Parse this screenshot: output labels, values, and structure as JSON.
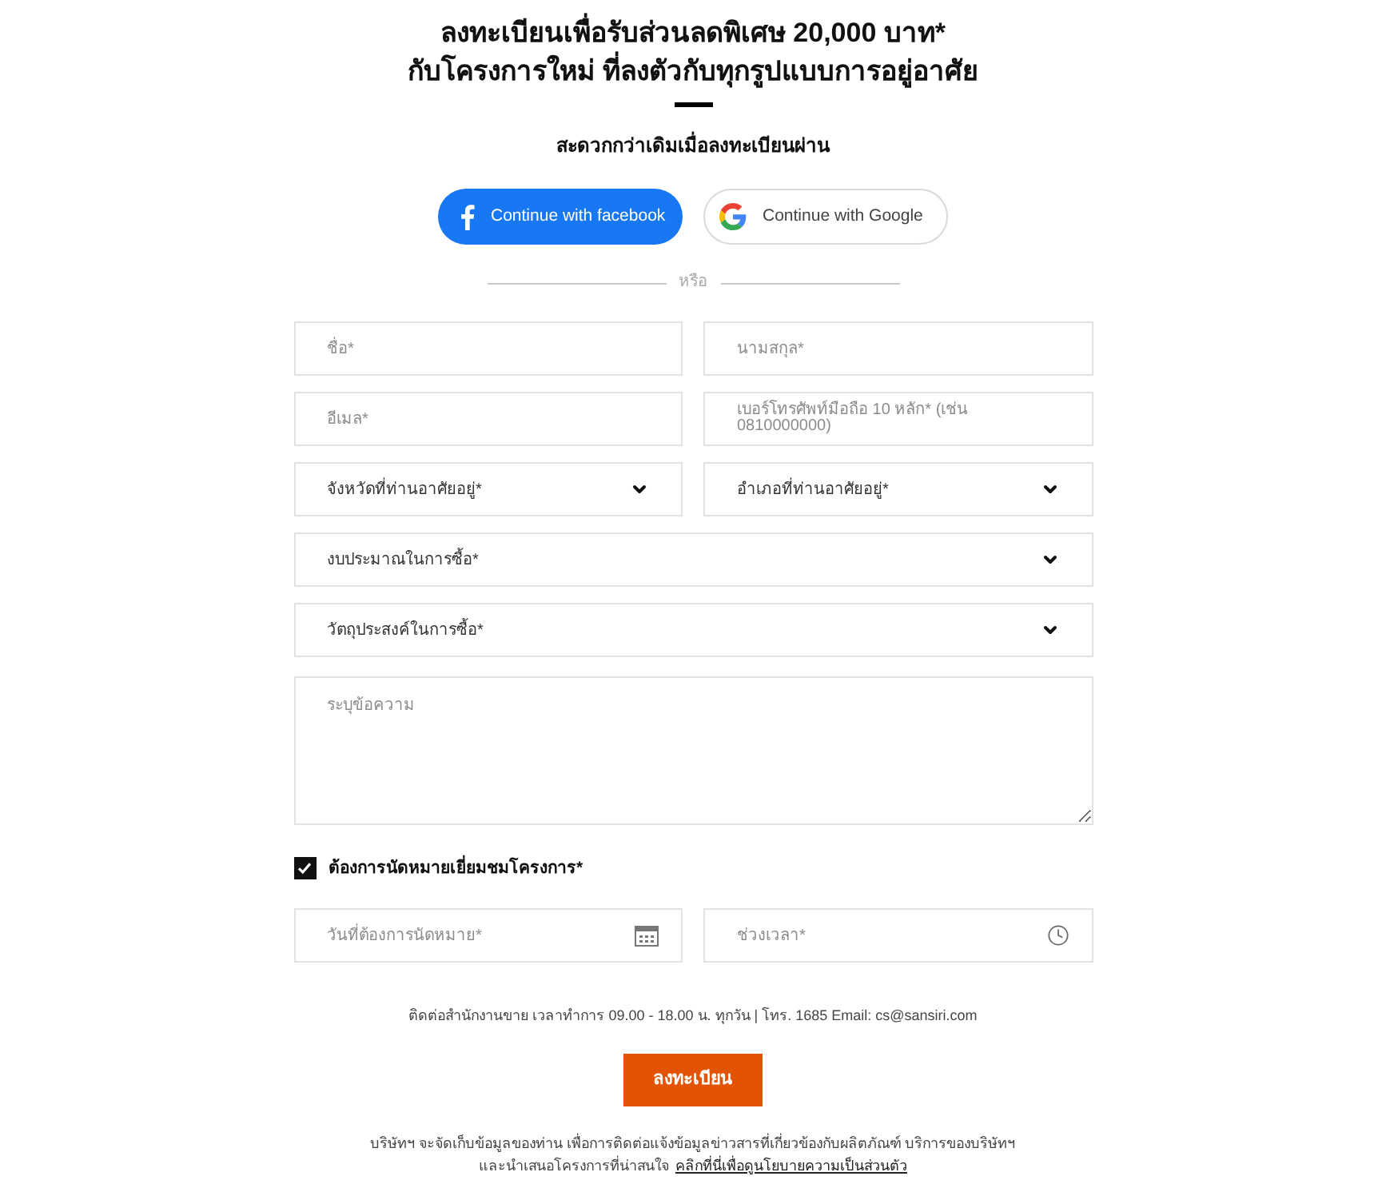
{
  "title_lines": [
    "ลงทะเบียนเพื่อรับส่วนลดพิเศษ 20,000 บาท*",
    "กับโครงการใหม่ ที่ลงตัวกับทุกรูปแบบการอยู่อาศัย"
  ],
  "subtitle": "สะดวกกว่าเดิมเมื่อลงทะเบียนผ่าน",
  "social_logins": [
    {
      "kind": "facebook",
      "label": "Continue with facebook"
    },
    {
      "kind": "google",
      "label": "Continue with Google"
    }
  ],
  "divider_text": "หรือ",
  "form_rows": [
    [
      {
        "kind": "text",
        "placeholder": "ชื่อ*"
      },
      {
        "kind": "text",
        "placeholder": "นามสกุล*"
      }
    ],
    [
      {
        "kind": "text",
        "placeholder": "อีเมล*"
      },
      {
        "kind": "phone",
        "placeholder": "เบอร์โทรศัพท์มือถือ 10 หลัก* (เช่น 0810000000)"
      }
    ],
    [
      {
        "kind": "select",
        "placeholder": "จังหวัดที่ท่านอาศัยอยู่*"
      },
      {
        "kind": "select",
        "placeholder": "อำเภอที่ท่านอาศัยอยู่*"
      }
    ],
    [
      {
        "kind": "select",
        "placeholder": "งบประมาณในการซื้อ*"
      }
    ],
    [
      {
        "kind": "select",
        "placeholder": "วัตถุประสงค์ในการซื้อ*"
      }
    ],
    [
      {
        "kind": "textarea",
        "placeholder": "ระบุข้อความ"
      }
    ]
  ],
  "appointment": {
    "label": "ต้องการนัดหมายเยี่ยมชมโครงการ*",
    "checked": true,
    "fields": [
      {
        "kind": "date",
        "placeholder": "วันที่ต้องการนัดหมาย*"
      },
      {
        "kind": "time",
        "placeholder": "ช่วงเวลา*"
      }
    ]
  },
  "contact_info": "ติดต่อสำนักงานขาย เวลาทำการ 09.00 - 18.00 น. ทุกวัน | โทร. 1685 Email: cs@sansiri.com",
  "submit_label": "ลงทะเบียน",
  "privacy_notice": {
    "lines": [
      "บริษัทฯ จะจัดเก็บข้อมูลของท่าน เพื่อการติดต่อแจ้งข้อมูลข่าวสารที่เกี่ยวข้องกับผลิตภัณฑ์ บริการของบริษัทฯ",
      "และนำเสนอโครงการที่น่าสนใจ"
    ],
    "link": "คลิกที่นี่เพื่อดูนโยบายความเป็นส่วนตัว"
  }
}
